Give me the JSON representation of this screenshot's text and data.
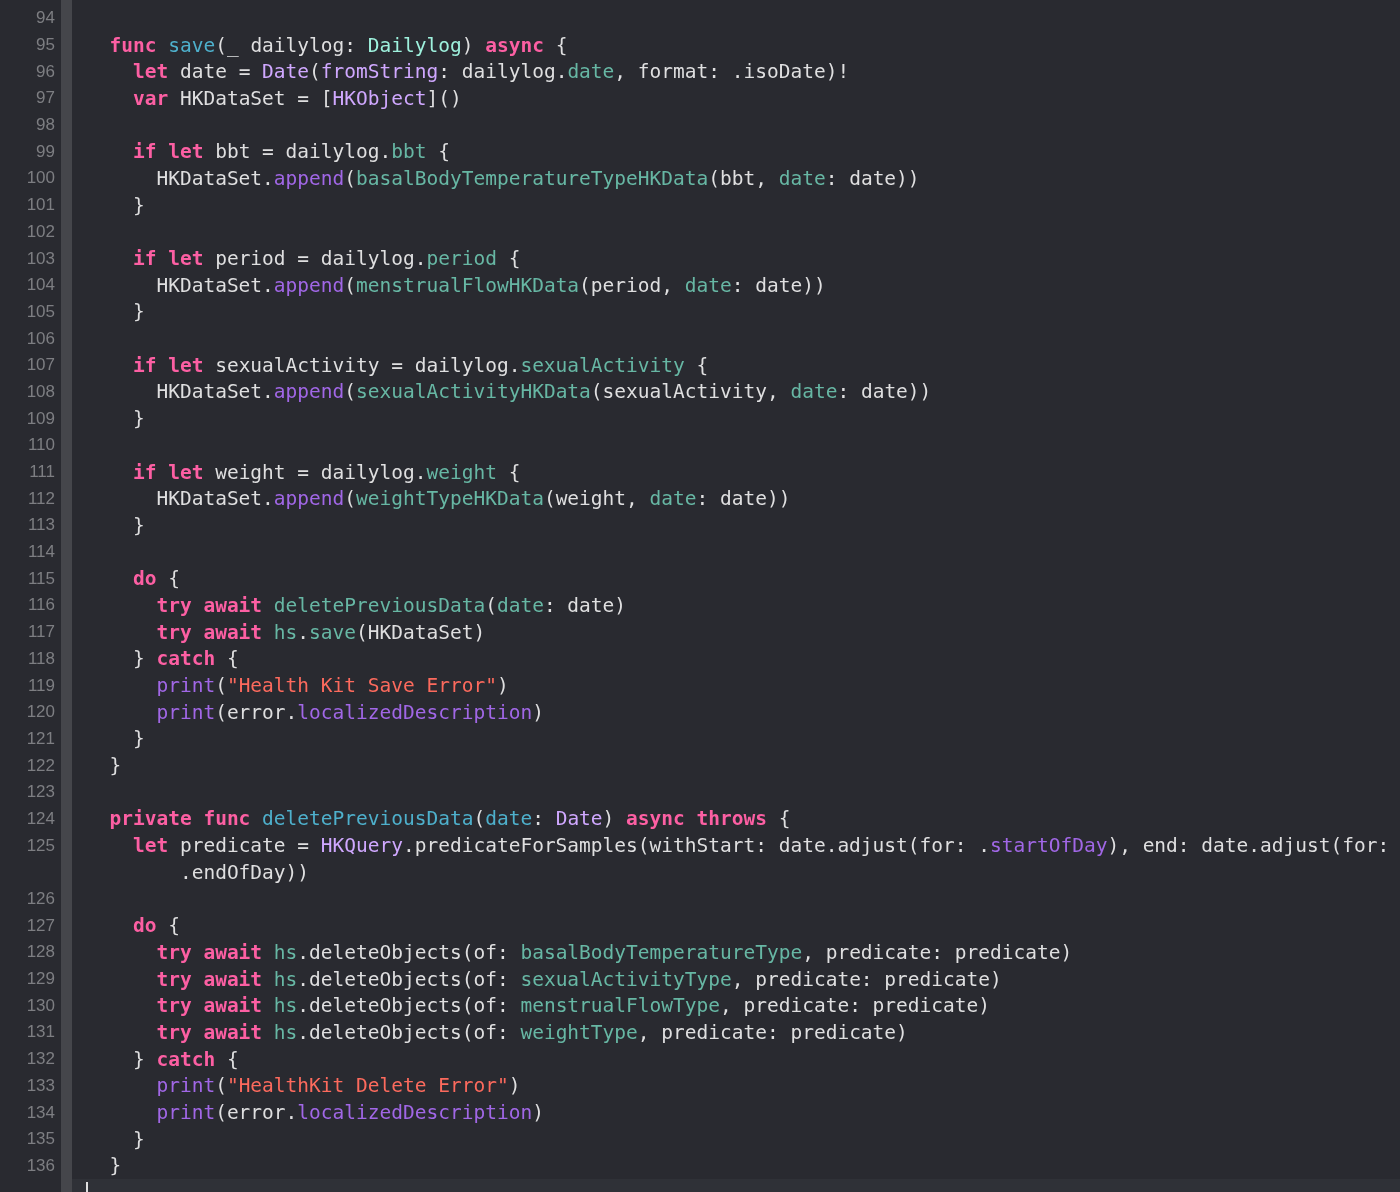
{
  "editor": {
    "lines": [
      {
        "number": "94",
        "current": false
      },
      {
        "number": "95",
        "current": false,
        "tokens": [
          {
            "kind": "k",
            "text": "  func"
          },
          {
            "kind": "d",
            "text": " save"
          },
          {
            "kind": "x",
            "text": "(_ dailylog: "
          },
          {
            "kind": "t",
            "text": "Dailylog"
          },
          {
            "kind": "x",
            "text": ") "
          },
          {
            "kind": "k",
            "text": "async"
          },
          {
            "kind": "x",
            "text": " {"
          }
        ]
      },
      {
        "number": "96",
        "current": false,
        "tokens": [
          {
            "kind": "k",
            "text": "    let"
          },
          {
            "kind": "x",
            "text": " date = "
          },
          {
            "kind": "s",
            "text": "Date"
          },
          {
            "kind": "x",
            "text": "("
          },
          {
            "kind": "s",
            "text": "fromString"
          },
          {
            "kind": "x",
            "text": ": dailylog."
          },
          {
            "kind": "p",
            "text": "date"
          },
          {
            "kind": "x",
            "text": ", format: .isoDate)!"
          }
        ]
      },
      {
        "number": "97",
        "current": false,
        "tokens": [
          {
            "kind": "k",
            "text": "    var"
          },
          {
            "kind": "x",
            "text": " HKDataSet = ["
          },
          {
            "kind": "s",
            "text": "HKObject"
          },
          {
            "kind": "x",
            "text": "]()"
          }
        ]
      },
      {
        "number": "98",
        "current": false
      },
      {
        "number": "99",
        "current": false,
        "tokens": [
          {
            "kind": "k",
            "text": "    if let"
          },
          {
            "kind": "x",
            "text": " bbt = dailylog."
          },
          {
            "kind": "p",
            "text": "bbt"
          },
          {
            "kind": "x",
            "text": " {"
          }
        ]
      },
      {
        "number": "100",
        "current": false,
        "tokens": [
          {
            "kind": "x",
            "text": "      HKDataSet."
          },
          {
            "kind": "m",
            "text": "append"
          },
          {
            "kind": "x",
            "text": "("
          },
          {
            "kind": "p",
            "text": "basalBodyTemperatureTypeHKData"
          },
          {
            "kind": "x",
            "text": "(bbt, "
          },
          {
            "kind": "p",
            "text": "date"
          },
          {
            "kind": "x",
            "text": ": date))"
          }
        ]
      },
      {
        "number": "101",
        "current": false,
        "tokens": [
          {
            "kind": "x",
            "text": "    }"
          }
        ]
      },
      {
        "number": "102",
        "current": false
      },
      {
        "number": "103",
        "current": false,
        "tokens": [
          {
            "kind": "k",
            "text": "    if let"
          },
          {
            "kind": "x",
            "text": " period = dailylog."
          },
          {
            "kind": "p",
            "text": "period"
          },
          {
            "kind": "x",
            "text": " {"
          }
        ]
      },
      {
        "number": "104",
        "current": false,
        "tokens": [
          {
            "kind": "x",
            "text": "      HKDataSet."
          },
          {
            "kind": "m",
            "text": "append"
          },
          {
            "kind": "x",
            "text": "("
          },
          {
            "kind": "p",
            "text": "menstrualFlowHKData"
          },
          {
            "kind": "x",
            "text": "(period, "
          },
          {
            "kind": "p",
            "text": "date"
          },
          {
            "kind": "x",
            "text": ": date))"
          }
        ]
      },
      {
        "number": "105",
        "current": false,
        "tokens": [
          {
            "kind": "x",
            "text": "    }"
          }
        ]
      },
      {
        "number": "106",
        "current": false
      },
      {
        "number": "107",
        "current": false,
        "tokens": [
          {
            "kind": "k",
            "text": "    if let"
          },
          {
            "kind": "x",
            "text": " sexualActivity = dailylog."
          },
          {
            "kind": "p",
            "text": "sexualActivity"
          },
          {
            "kind": "x",
            "text": " {"
          }
        ]
      },
      {
        "number": "108",
        "current": false,
        "tokens": [
          {
            "kind": "x",
            "text": "      HKDataSet."
          },
          {
            "kind": "m",
            "text": "append"
          },
          {
            "kind": "x",
            "text": "("
          },
          {
            "kind": "p",
            "text": "sexualActivityHKData"
          },
          {
            "kind": "x",
            "text": "(sexualActivity, "
          },
          {
            "kind": "p",
            "text": "date"
          },
          {
            "kind": "x",
            "text": ": date))"
          }
        ]
      },
      {
        "number": "109",
        "current": false,
        "tokens": [
          {
            "kind": "x",
            "text": "    }"
          }
        ]
      },
      {
        "number": "110",
        "current": false
      },
      {
        "number": "111",
        "current": false,
        "tokens": [
          {
            "kind": "k",
            "text": "    if let"
          },
          {
            "kind": "x",
            "text": " weight = dailylog."
          },
          {
            "kind": "p",
            "text": "weight"
          },
          {
            "kind": "x",
            "text": " {"
          }
        ]
      },
      {
        "number": "112",
        "current": false,
        "tokens": [
          {
            "kind": "x",
            "text": "      HKDataSet."
          },
          {
            "kind": "m",
            "text": "append"
          },
          {
            "kind": "x",
            "text": "("
          },
          {
            "kind": "p",
            "text": "weightTypeHKData"
          },
          {
            "kind": "x",
            "text": "(weight, "
          },
          {
            "kind": "p",
            "text": "date"
          },
          {
            "kind": "x",
            "text": ": date))"
          }
        ]
      },
      {
        "number": "113",
        "current": false,
        "tokens": [
          {
            "kind": "x",
            "text": "    }"
          }
        ]
      },
      {
        "number": "114",
        "current": false
      },
      {
        "number": "115",
        "current": false,
        "tokens": [
          {
            "kind": "k",
            "text": "    do"
          },
          {
            "kind": "x",
            "text": " {"
          }
        ]
      },
      {
        "number": "116",
        "current": false,
        "tokens": [
          {
            "kind": "k",
            "text": "      try await"
          },
          {
            "kind": "p",
            "text": " deletePreviousData"
          },
          {
            "kind": "x",
            "text": "("
          },
          {
            "kind": "p",
            "text": "date"
          },
          {
            "kind": "x",
            "text": ": date)"
          }
        ]
      },
      {
        "number": "117",
        "current": false,
        "tokens": [
          {
            "kind": "k",
            "text": "      try await"
          },
          {
            "kind": "p",
            "text": " hs"
          },
          {
            "kind": "x",
            "text": "."
          },
          {
            "kind": "p",
            "text": "save"
          },
          {
            "kind": "x",
            "text": "(HKDataSet)"
          }
        ]
      },
      {
        "number": "118",
        "current": false,
        "tokens": [
          {
            "kind": "x",
            "text": "    } "
          },
          {
            "kind": "k",
            "text": "catch"
          },
          {
            "kind": "x",
            "text": " {"
          }
        ]
      },
      {
        "number": "119",
        "current": false,
        "tokens": [
          {
            "kind": "m",
            "text": "      print"
          },
          {
            "kind": "x",
            "text": "("
          },
          {
            "kind": "q",
            "text": "\"Health Kit Save Error\""
          },
          {
            "kind": "x",
            "text": ")"
          }
        ]
      },
      {
        "number": "120",
        "current": false,
        "tokens": [
          {
            "kind": "m",
            "text": "      print"
          },
          {
            "kind": "x",
            "text": "(error."
          },
          {
            "kind": "m",
            "text": "localizedDescription"
          },
          {
            "kind": "x",
            "text": ")"
          }
        ]
      },
      {
        "number": "121",
        "current": false,
        "tokens": [
          {
            "kind": "x",
            "text": "    }"
          }
        ]
      },
      {
        "number": "122",
        "current": false,
        "tokens": [
          {
            "kind": "x",
            "text": "  }"
          }
        ]
      },
      {
        "number": "123",
        "current": false
      },
      {
        "number": "124",
        "current": false,
        "tokens": [
          {
            "kind": "k",
            "text": "  private func"
          },
          {
            "kind": "d",
            "text": " deletePreviousData"
          },
          {
            "kind": "x",
            "text": "("
          },
          {
            "kind": "d",
            "text": "date"
          },
          {
            "kind": "x",
            "text": ": "
          },
          {
            "kind": "s",
            "text": "Date"
          },
          {
            "kind": "x",
            "text": ") "
          },
          {
            "kind": "k",
            "text": "async throws"
          },
          {
            "kind": "x",
            "text": " {"
          }
        ]
      },
      {
        "number": "125",
        "current": false,
        "tokens": [
          {
            "kind": "k",
            "text": "    let"
          },
          {
            "kind": "x",
            "text": " predicate = "
          },
          {
            "kind": "s",
            "text": "HKQuery"
          },
          {
            "kind": "x",
            "text": ".predicateForSamples(withStart: date.adjust(for: ."
          },
          {
            "kind": "m",
            "text": "startOfDay"
          },
          {
            "kind": "x",
            "text": "), end: date.adjust(for:"
          }
        ]
      },
      {
        "current": false,
        "tokens": [
          {
            "kind": "x",
            "text": "        .endOfDay))"
          }
        ]
      },
      {
        "number": "126",
        "current": false
      },
      {
        "number": "127",
        "current": false,
        "tokens": [
          {
            "kind": "k",
            "text": "    do"
          },
          {
            "kind": "x",
            "text": " {"
          }
        ]
      },
      {
        "number": "128",
        "current": false,
        "tokens": [
          {
            "kind": "k",
            "text": "      try await"
          },
          {
            "kind": "p",
            "text": " hs"
          },
          {
            "kind": "x",
            "text": ".deleteObjects(of: "
          },
          {
            "kind": "p",
            "text": "basalBodyTemperatureType"
          },
          {
            "kind": "x",
            "text": ", predicate: predicate)"
          }
        ]
      },
      {
        "number": "129",
        "current": false,
        "tokens": [
          {
            "kind": "k",
            "text": "      try await"
          },
          {
            "kind": "p",
            "text": " hs"
          },
          {
            "kind": "x",
            "text": ".deleteObjects(of: "
          },
          {
            "kind": "p",
            "text": "sexualActivityType"
          },
          {
            "kind": "x",
            "text": ", predicate: predicate)"
          }
        ]
      },
      {
        "number": "130",
        "current": false,
        "tokens": [
          {
            "kind": "k",
            "text": "      try await"
          },
          {
            "kind": "p",
            "text": " hs"
          },
          {
            "kind": "x",
            "text": ".deleteObjects(of: "
          },
          {
            "kind": "p",
            "text": "menstrualFlowType"
          },
          {
            "kind": "x",
            "text": ", predicate: predicate)"
          }
        ]
      },
      {
        "number": "131",
        "current": false,
        "tokens": [
          {
            "kind": "k",
            "text": "      try await"
          },
          {
            "kind": "p",
            "text": " hs"
          },
          {
            "kind": "x",
            "text": ".deleteObjects(of: "
          },
          {
            "kind": "p",
            "text": "weightType"
          },
          {
            "kind": "x",
            "text": ", predicate: predicate)"
          }
        ]
      },
      {
        "number": "132",
        "current": false,
        "tokens": [
          {
            "kind": "x",
            "text": "    } "
          },
          {
            "kind": "k",
            "text": "catch"
          },
          {
            "kind": "x",
            "text": " {"
          }
        ]
      },
      {
        "number": "133",
        "current": false,
        "tokens": [
          {
            "kind": "m",
            "text": "      print"
          },
          {
            "kind": "x",
            "text": "("
          },
          {
            "kind": "q",
            "text": "\"HealthKit Delete Error\""
          },
          {
            "kind": "x",
            "text": ")"
          }
        ]
      },
      {
        "number": "134",
        "current": false,
        "tokens": [
          {
            "kind": "m",
            "text": "      print"
          },
          {
            "kind": "x",
            "text": "(error."
          },
          {
            "kind": "m",
            "text": "localizedDescription"
          },
          {
            "kind": "x",
            "text": ")"
          }
        ]
      },
      {
        "number": "135",
        "current": false,
        "tokens": [
          {
            "kind": "x",
            "text": "    }"
          }
        ]
      },
      {
        "number": "136",
        "current": false,
        "tokens": [
          {
            "kind": "x",
            "text": "  }"
          }
        ]
      },
      {
        "current": true
      }
    ]
  }
}
